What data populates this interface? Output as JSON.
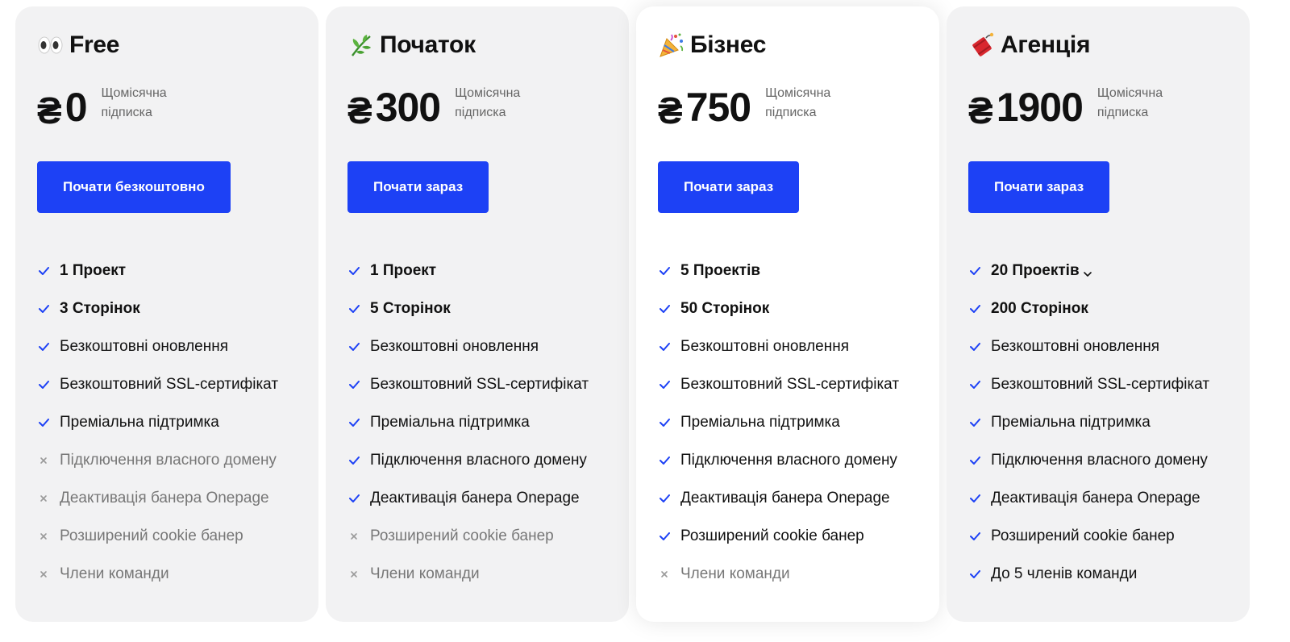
{
  "plans": [
    {
      "name": "Free",
      "icon": "eyes-icon",
      "currency": "₴",
      "price": "0",
      "period": "Щомісячна підписка",
      "cta": "Почати безкоштовно",
      "features": [
        {
          "label": "1 Проект",
          "included": true
        },
        {
          "label": "3 Сторінок",
          "included": true
        },
        {
          "label": "Безкоштовні оновлення",
          "included": true
        },
        {
          "label": "Безкоштовний SSL-сертифікат",
          "included": true
        },
        {
          "label": "Преміальна підтримка",
          "included": true
        },
        {
          "label": "Підключення власного домену",
          "included": false
        },
        {
          "label": "Деактивація банера Onepage",
          "included": false
        },
        {
          "label": "Розширений cookie банер",
          "included": false
        },
        {
          "label": "Члени команди",
          "included": false
        }
      ]
    },
    {
      "name": "Початок",
      "icon": "herb-icon",
      "currency": "₴",
      "price": "300",
      "period": "Щомісячна підписка",
      "cta": "Почати зараз",
      "features": [
        {
          "label": "1 Проект",
          "included": true
        },
        {
          "label": "5 Сторінок",
          "included": true
        },
        {
          "label": "Безкоштовні оновлення",
          "included": true
        },
        {
          "label": "Безкоштовний SSL-сертифікат",
          "included": true
        },
        {
          "label": "Преміальна підтримка",
          "included": true
        },
        {
          "label": "Підключення власного домену",
          "included": true
        },
        {
          "label": "Деактивація банера Onepage",
          "included": true
        },
        {
          "label": "Розширений cookie банер",
          "included": false
        },
        {
          "label": "Члени команди",
          "included": false
        }
      ]
    },
    {
      "name": "Бізнес",
      "icon": "party-popper-icon",
      "currency": "₴",
      "price": "750",
      "period": "Щомісячна підписка",
      "cta": "Почати зараз",
      "features": [
        {
          "label": "5 Проектів",
          "included": true
        },
        {
          "label": "50 Сторінок",
          "included": true
        },
        {
          "label": "Безкоштовні оновлення",
          "included": true
        },
        {
          "label": "Безкоштовний SSL-сертифікат",
          "included": true
        },
        {
          "label": "Преміальна підтримка",
          "included": true
        },
        {
          "label": "Підключення власного домену",
          "included": true
        },
        {
          "label": "Деактивація банера Onepage",
          "included": true
        },
        {
          "label": "Розширений cookie банер",
          "included": true
        },
        {
          "label": "Члени команди",
          "included": false
        }
      ]
    },
    {
      "name": "Агенція",
      "icon": "firecracker-icon",
      "currency": "₴",
      "price": "1900",
      "period": "Щомісячна підписка",
      "cta": "Почати зараз",
      "features": [
        {
          "label": "20 Проектів",
          "included": true,
          "dropdown": true
        },
        {
          "label": "200 Сторінок",
          "included": true
        },
        {
          "label": "Безкоштовні оновлення",
          "included": true
        },
        {
          "label": "Безкоштовний SSL-сертифікат",
          "included": true
        },
        {
          "label": "Преміальна підтримка",
          "included": true
        },
        {
          "label": "Підключення власного домену",
          "included": true
        },
        {
          "label": "Деактивація банера Onepage",
          "included": true
        },
        {
          "label": "Розширений cookie банер",
          "included": true
        },
        {
          "label": "До 5 членів команди",
          "included": true
        }
      ]
    }
  ],
  "colors": {
    "accent": "#1d41f5",
    "check": "#1d41f5",
    "cross": "#9a9a9a",
    "card_bg": "#f2f2f3",
    "featured_bg": "#ffffff"
  }
}
